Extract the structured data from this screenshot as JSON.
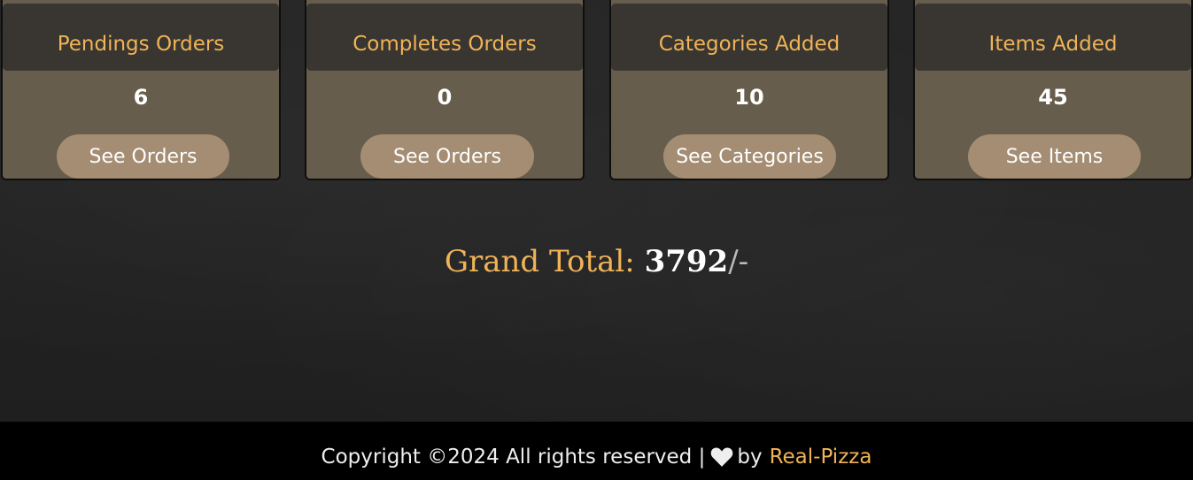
{
  "cards": [
    {
      "title": "Pendings Orders",
      "count": "6",
      "button": "See Orders"
    },
    {
      "title": "Completes Orders",
      "count": "0",
      "button": "See Orders"
    },
    {
      "title": "Categories Added",
      "count": "10",
      "button": "See Categories"
    },
    {
      "title": "Items Added",
      "count": "45",
      "button": "See Items"
    }
  ],
  "grand_total": {
    "label": "Grand Total:",
    "value": "3792",
    "suffix": "/-"
  },
  "footer": {
    "text": "Copyright ©2024 All rights reserved |",
    "by": "by",
    "brand": "Real-Pizza",
    "icon": "heart-icon"
  },
  "colors": {
    "accent": "#f0b357",
    "card_bg": "#675d4c",
    "card_header": "#393631",
    "button_bg": "#a48d73"
  }
}
